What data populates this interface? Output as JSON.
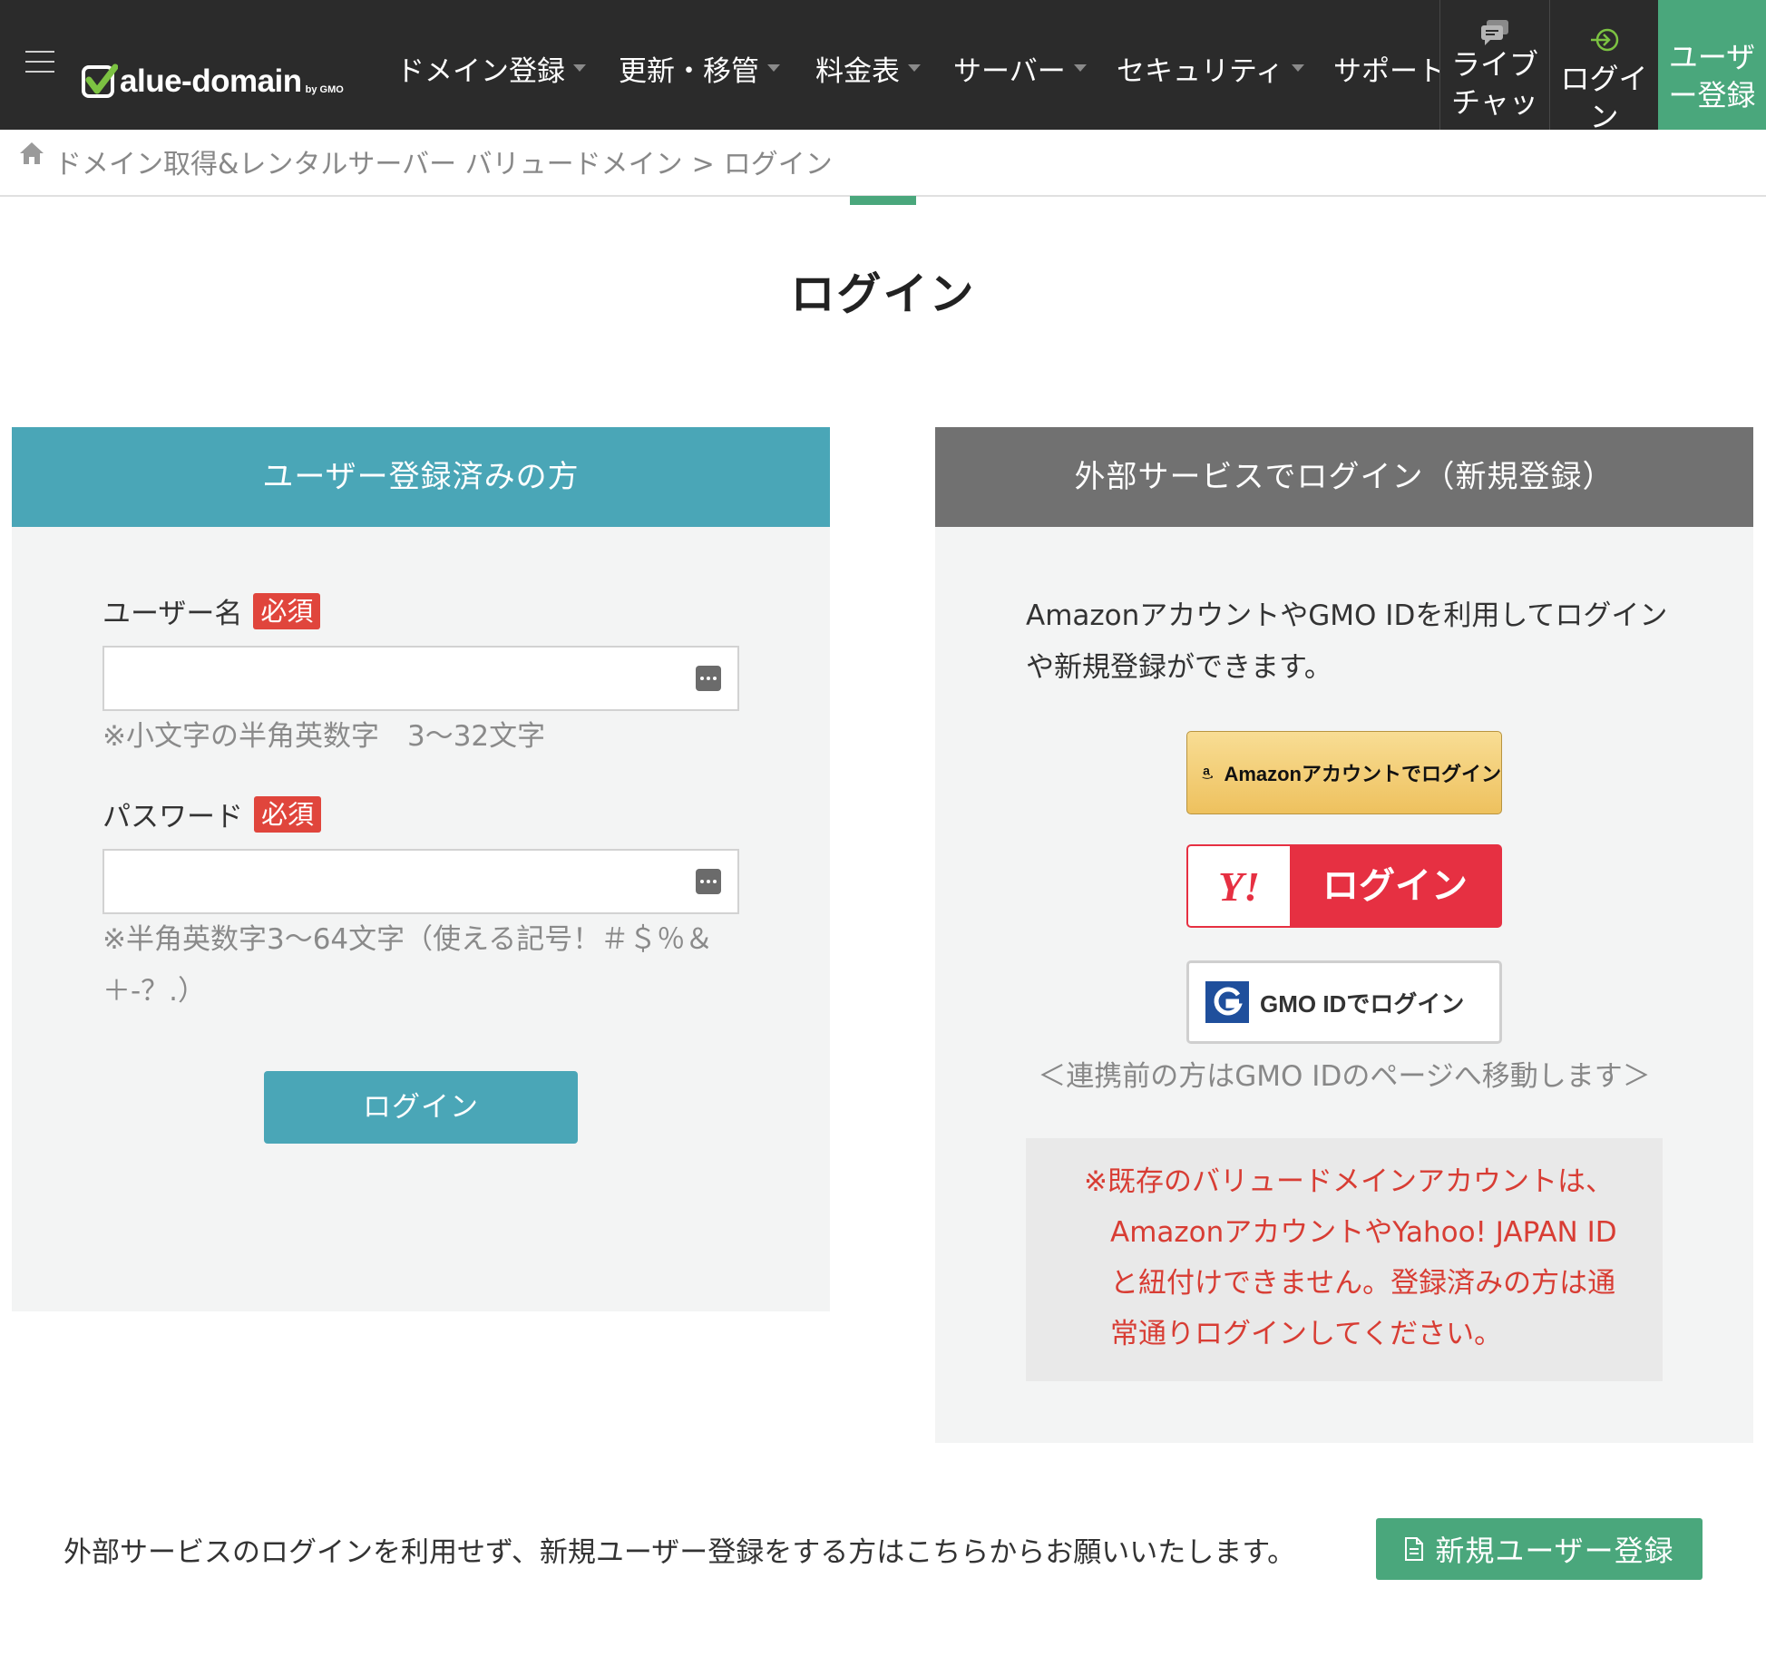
{
  "header": {
    "logo_text": "alue-domain",
    "logo_by": "by GMO",
    "nav": [
      {
        "label": "ドメイン登録",
        "icon": "caret-down-icon"
      },
      {
        "label": "更新・移管",
        "icon": "caret-down-icon"
      },
      {
        "label": "料金表",
        "icon": "caret-down-icon"
      },
      {
        "label": "サーバー",
        "icon": "caret-down-icon"
      },
      {
        "label": "セキュリティ",
        "icon": "caret-down-icon"
      },
      {
        "label": "サポート",
        "icon": "caret-down-icon"
      }
    ],
    "live_chat_label": "ライブチャッ",
    "login_label": "ログイン",
    "user_register_label": "ユーザー登録",
    "colors": {
      "bar": "#2b2b2b",
      "user_button": "#4aa77c"
    }
  },
  "breadcrumb": {
    "home_icon": "home-icon",
    "home_label": "ドメイン取得&レンタルサーバー バリュードメイン",
    "separator": ">",
    "current": "ログイン"
  },
  "page": {
    "title": "ログイン"
  },
  "registered": {
    "heading": "ユーザー登録済みの方",
    "username_label": "ユーザー名",
    "required_badge": "必須",
    "username_value": "",
    "username_hint": "※小文字の半角英数字　3〜32文字",
    "password_label": "パスワード",
    "password_value": "",
    "password_hint": "※半角英数字3〜64文字（使える記号！＃＄％＆＋-？.）",
    "login_button": "ログイン",
    "color": "#4aa6b7"
  },
  "external": {
    "heading": "外部サービスでログイン（新規登録）",
    "description": "AmazonアカウントやGMO IDを利用してログインや新規登録ができます。",
    "amazon_button": "Amazonアカウントでログイン",
    "yahoo_mark": "Y!",
    "yahoo_button": "ログイン",
    "gmo_button": "GMO IDでログイン",
    "gmo_note": "＜連携前の方はGMO IDのページへ移動します＞",
    "warning_first": "※既存のバリュードメインアカウントは、",
    "warning_rest": "AmazonアカウントやYahoo! JAPAN IDと紐付けできません。登録済みの方は通常通りログインしてください。",
    "colors": {
      "heading": "#717171",
      "warning": "#d83d34",
      "yahoo": "#e63042"
    }
  },
  "footer_cta": {
    "text": "外部サービスのログインを利用せず、新規ユーザー登録をする方はこちらからお願いいたします。",
    "button": "新規ユーザー登録",
    "button_icon": "document-icon"
  }
}
